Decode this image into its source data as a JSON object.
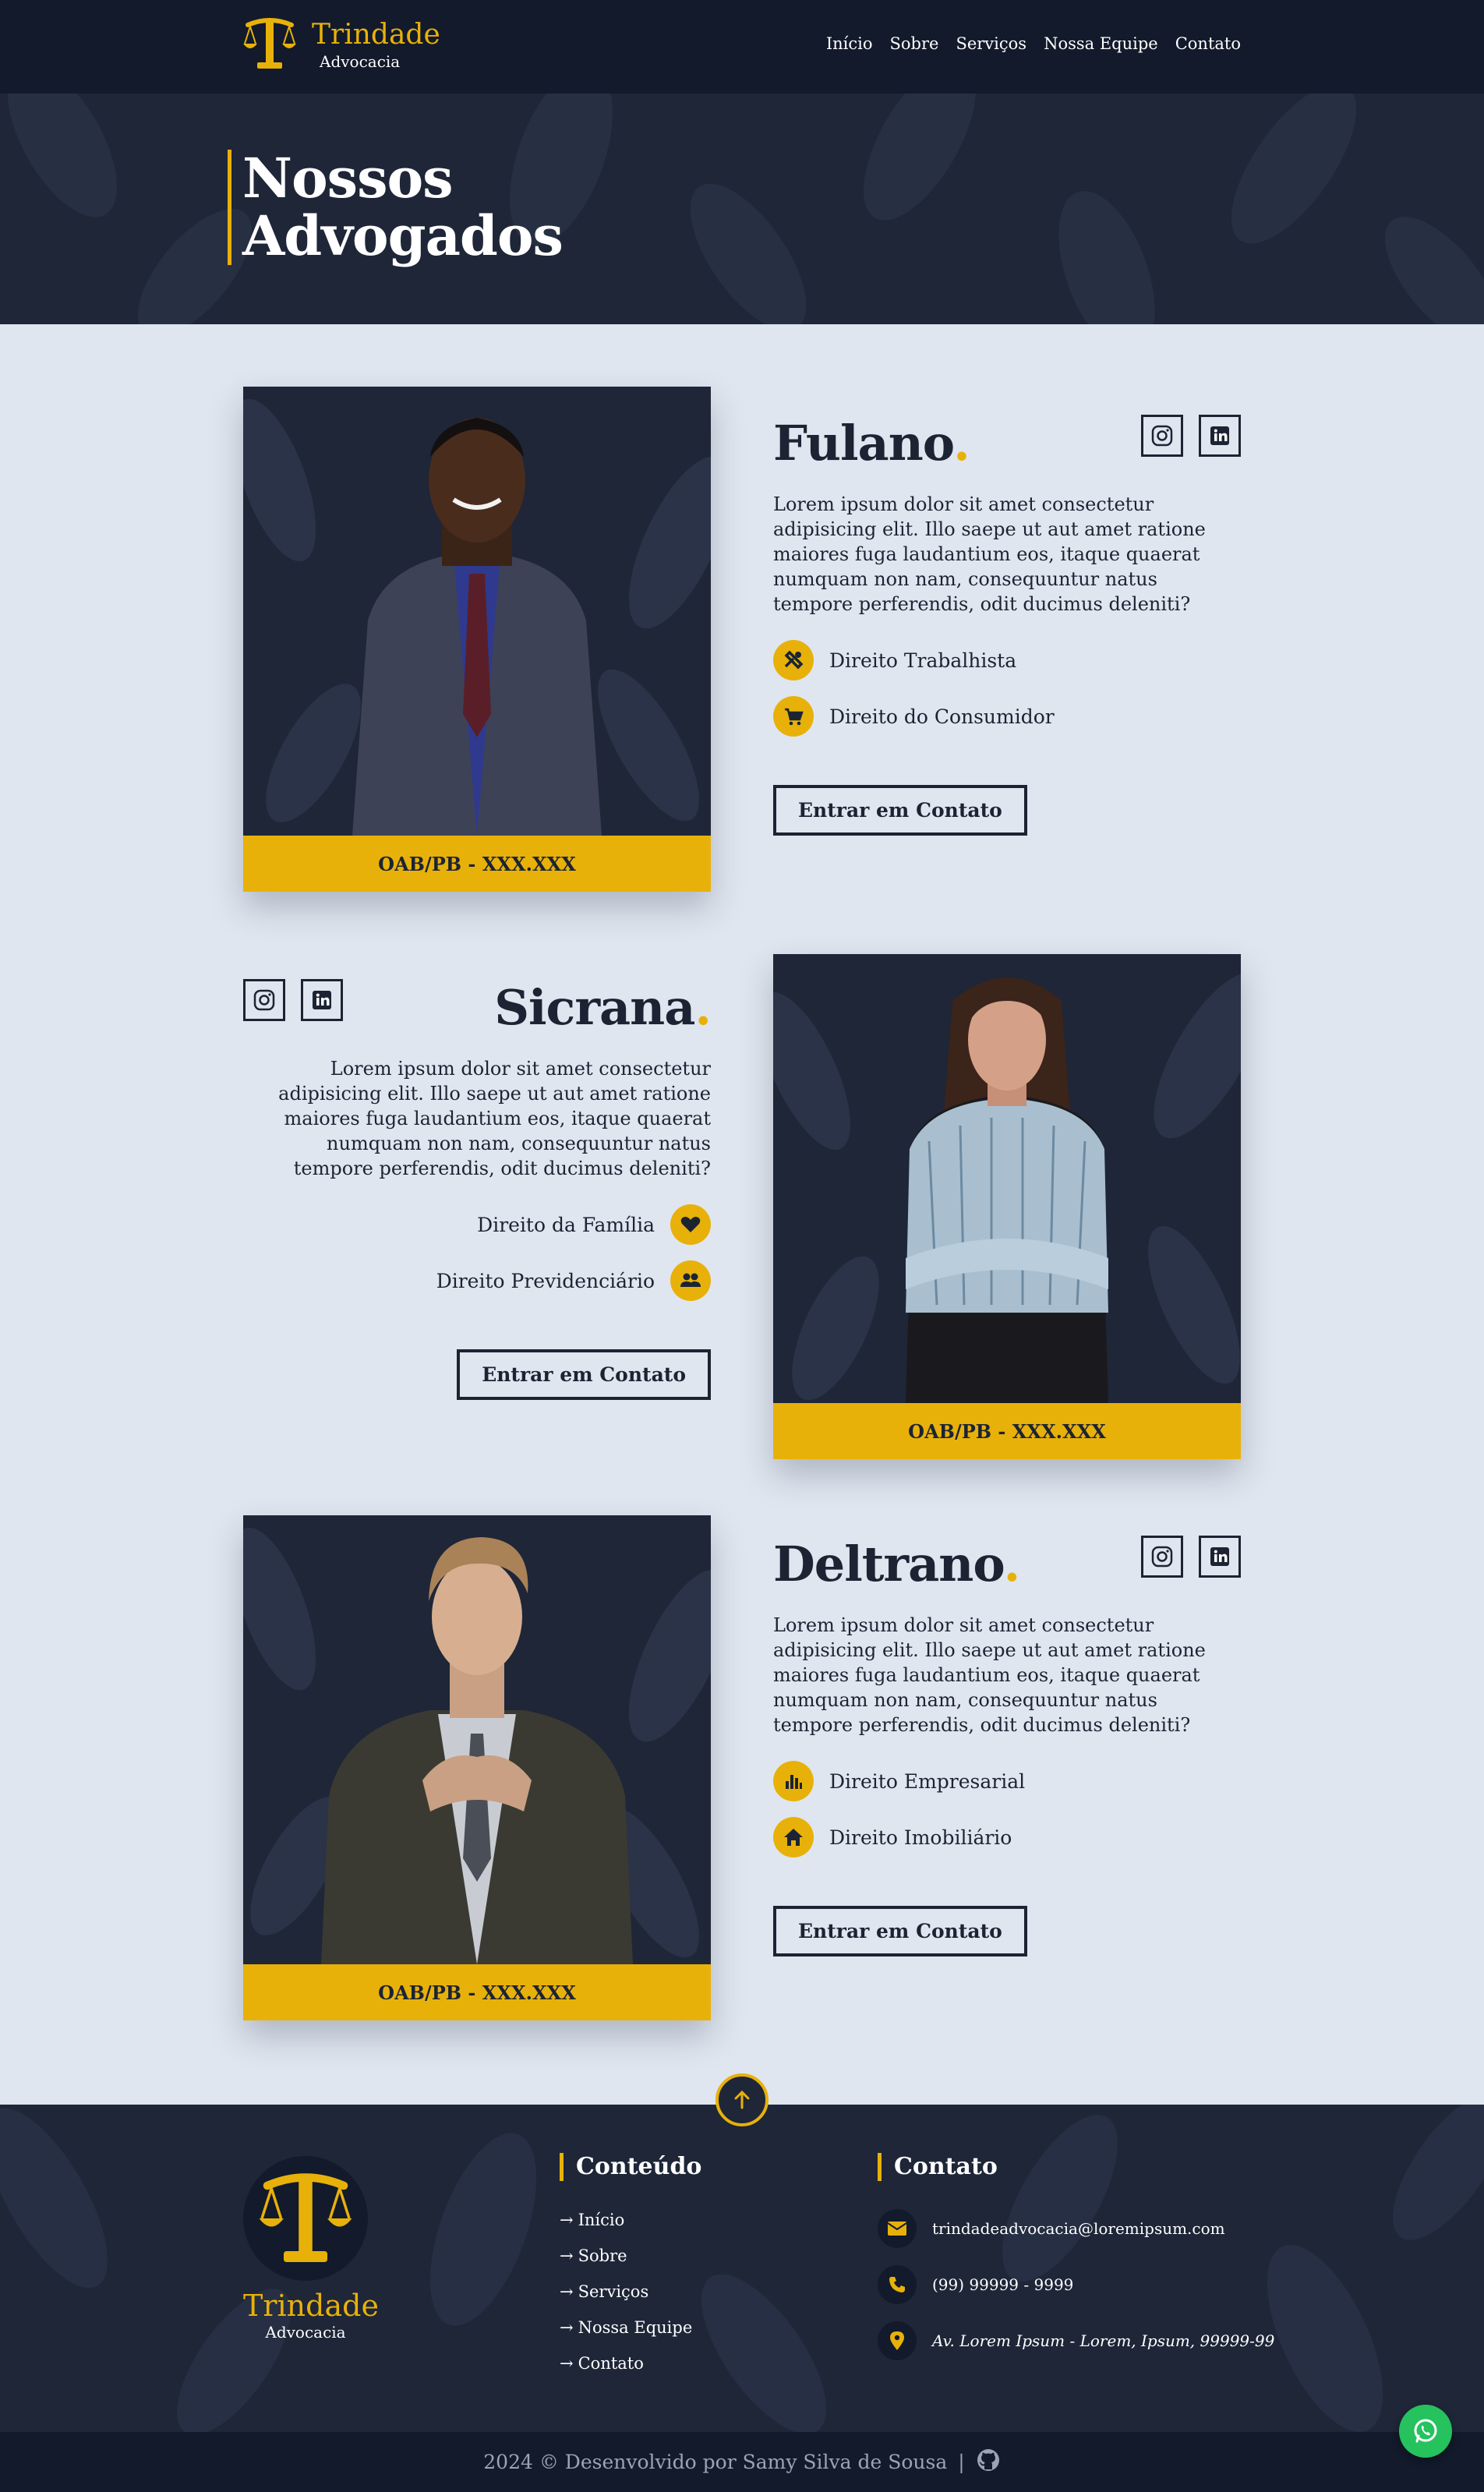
{
  "header": {
    "brand": "Trindade",
    "brand_sub": "Advocacia",
    "nav": [
      "Início",
      "Sobre",
      "Serviços",
      "Nossa Equipe",
      "Contato"
    ]
  },
  "hero": {
    "title_line1": "Nossos",
    "title_line2": "Advogados"
  },
  "lawyers": [
    {
      "name": "Fulano",
      "dot": ".",
      "description": "Lorem ipsum dolor sit amet consectetur adipisicing elit. Illo saepe ut aut amet ratione maiores fuga laudantium eos, itaque quaerat numquam non nam, consequuntur natus tempore perferendis, odit ducimus deleniti?",
      "specialties": [
        {
          "label": "Direito Trabalhista",
          "icon": "tools-icon"
        },
        {
          "label": "Direito do Consumidor",
          "icon": "cart-icon"
        }
      ],
      "button": "Entrar em Contato",
      "oab": "OAB/PB - XXX.XXX"
    },
    {
      "name": "Sicrana",
      "dot": ".",
      "description": "Lorem ipsum dolor sit amet consectetur adipisicing elit. Illo saepe ut aut amet ratione maiores fuga laudantium eos, itaque quaerat numquam non nam, consequuntur natus tempore perferendis, odit ducimus deleniti?",
      "specialties": [
        {
          "label": "Direito da Família",
          "icon": "heart-icon"
        },
        {
          "label": "Direito Previdenciário",
          "icon": "people-icon"
        }
      ],
      "button": "Entrar em Contato",
      "oab": "OAB/PB - XXX.XXX"
    },
    {
      "name": "Deltrano",
      "dot": ".",
      "description": "Lorem ipsum dolor sit amet consectetur adipisicing elit. Illo saepe ut aut amet ratione maiores fuga laudantium eos, itaque quaerat numquam non nam, consequuntur natus tempore perferendis, odit ducimus deleniti?",
      "specialties": [
        {
          "label": "Direito Empresarial",
          "icon": "bar-chart-icon"
        },
        {
          "label": "Direito Imobiliário",
          "icon": "house-icon"
        }
      ],
      "button": "Entrar em Contato",
      "oab": "OAB/PB - XXX.XXX"
    }
  ],
  "footer": {
    "brand": "Trindade",
    "brand_sub": "Advocacia",
    "content_title": "Conteúdo",
    "content_links": [
      "Início",
      "Sobre",
      "Serviços",
      "Nossa Equipe",
      "Contato"
    ],
    "contact_title": "Contato",
    "email": "trindadeadvocacia@loremipsum.com",
    "phone": "(99) 99999 - 9999",
    "address": "Av. Lorem Ipsum - Lorem, Ipsum, 99999-99",
    "copyright": "2024 © Desenvolvido por Samy Silva de Sousa",
    "separator": "|"
  },
  "colors": {
    "navy": "#1e2638",
    "navy_dark": "#121a2b",
    "gold": "#e8b10a",
    "page_bg": "#dfe6f0",
    "whatsapp": "#25c25e"
  }
}
